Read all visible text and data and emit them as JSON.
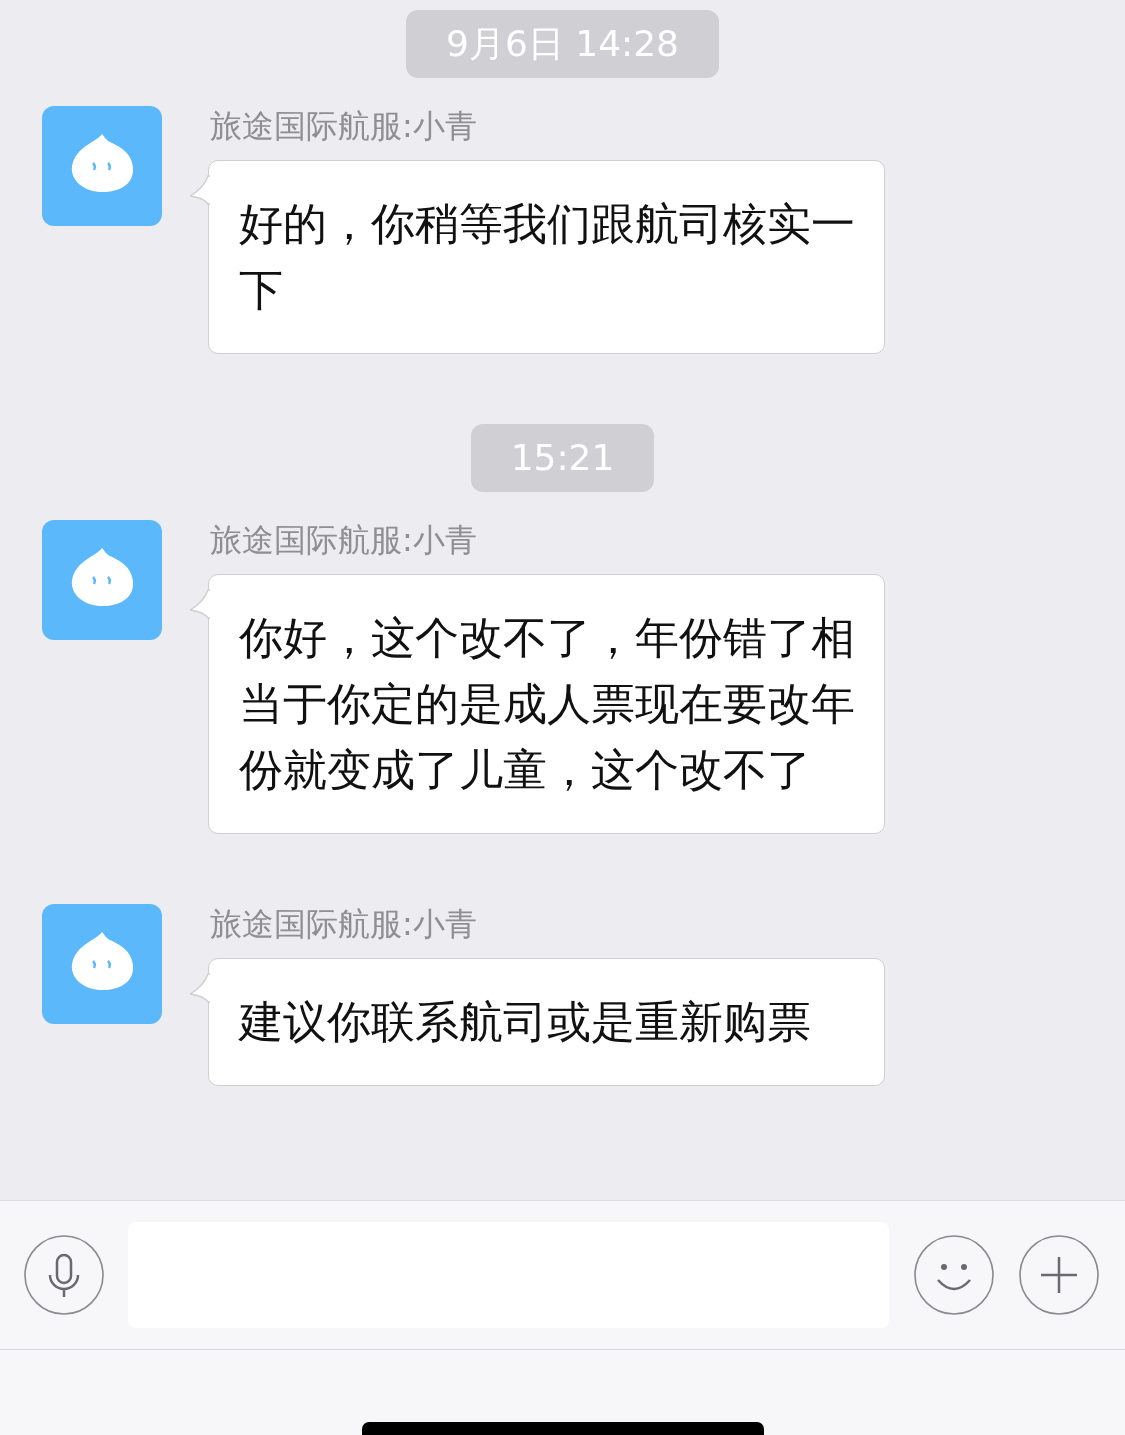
{
  "messages": [
    {
      "kind": "time",
      "text": "9月6日 14:28"
    },
    {
      "kind": "message",
      "sender": "旅途国际航服:小青",
      "text": "好的，你稍等我们跟航司核实一下"
    },
    {
      "kind": "time",
      "text": "15:21"
    },
    {
      "kind": "message",
      "sender": "旅途国际航服:小青",
      "text": "你好，这个改不了，年份错了相当于你定的是成人票现在要改年份就变成了儿童，这个改不了"
    },
    {
      "kind": "message",
      "sender": "旅途国际航服:小青",
      "text": "建议你联系航司或是重新购票"
    }
  ]
}
